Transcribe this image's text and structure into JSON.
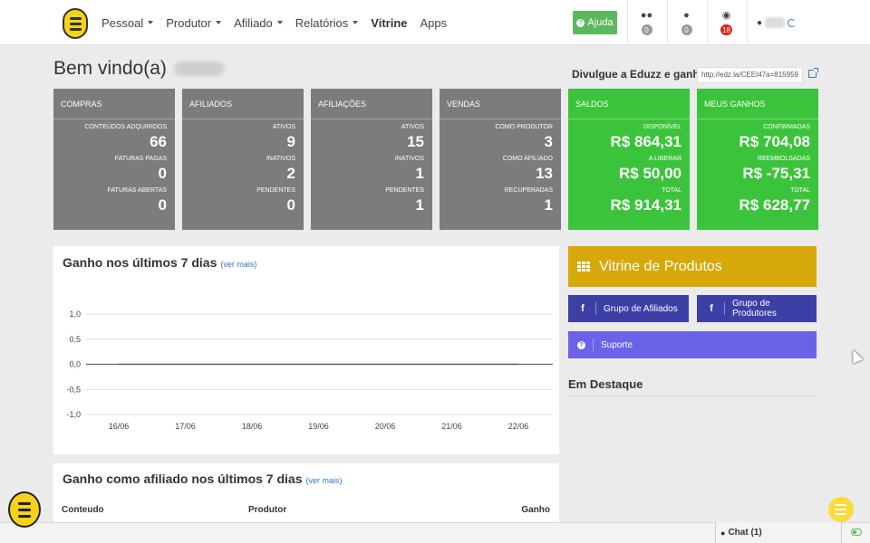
{
  "nav": {
    "menu": [
      {
        "label": "Pessoal",
        "dropdown": true
      },
      {
        "label": "Produtor",
        "dropdown": true
      },
      {
        "label": "Afiliado",
        "dropdown": true
      },
      {
        "label": "Relatórios",
        "dropdown": true
      },
      {
        "label": "Vitrine",
        "dropdown": false
      },
      {
        "label": "Apps",
        "dropdown": false
      }
    ],
    "help_label": "Ajuda",
    "users_count": "0",
    "messages_count": "0",
    "notifications_count": "18"
  },
  "welcome": "Bem vindo(a)",
  "promo": {
    "label": "Divulgue a Eduzz e ganhe!",
    "ref_link": "http://edz.la/CEEI47a=815959"
  },
  "stats": [
    {
      "title": "COMPRAS",
      "rows": [
        {
          "label": "CONTEÚDOS ADQUIRIDOS",
          "value": "66"
        },
        {
          "label": "FATURAS PAGAS",
          "value": "0"
        },
        {
          "label": "FATURAS ABERTAS",
          "value": "0"
        }
      ]
    },
    {
      "title": "AFILIADOS",
      "rows": [
        {
          "label": "ATIVOS",
          "value": "9"
        },
        {
          "label": "INATIVOS",
          "value": "2"
        },
        {
          "label": "PENDENTES",
          "value": "0"
        }
      ]
    },
    {
      "title": "AFILIAÇÕES",
      "rows": [
        {
          "label": "ATIVOS",
          "value": "15"
        },
        {
          "label": "INATIVOS",
          "value": "1"
        },
        {
          "label": "PENDENTES",
          "value": "1"
        }
      ]
    },
    {
      "title": "VENDAS",
      "rows": [
        {
          "label": "COMO PRODUTOR",
          "value": "3"
        },
        {
          "label": "COMO AFILIADO",
          "value": "13"
        },
        {
          "label": "RECUPERADAS",
          "value": "1"
        }
      ]
    },
    {
      "title": "SALDOS",
      "rows": [
        {
          "label": "DISPONÍVEL",
          "value": "R$ 864,31"
        },
        {
          "label": "A LIBERAR",
          "value": "R$ 50,00"
        },
        {
          "label": "TOTAL",
          "value": "R$ 914,31"
        }
      ]
    },
    {
      "title": "MEUS GANHOS",
      "rows": [
        {
          "label": "CONFIRMADAS",
          "value": "R$ 704,08"
        },
        {
          "label": "REEMBOLSADAS",
          "value": "R$ -75,31"
        },
        {
          "label": "TOTAL",
          "value": "R$ 628,77"
        }
      ]
    }
  ],
  "chart_card": {
    "title": "Ganho nos últimos 7 dias",
    "more": "(ver mais)"
  },
  "chart_data": {
    "type": "line",
    "x": [
      "16/06",
      "17/06",
      "18/06",
      "19/06",
      "20/06",
      "21/06",
      "22/06"
    ],
    "series": [
      {
        "values": [
          0,
          0,
          0,
          0,
          0,
          0,
          0
        ]
      }
    ],
    "yticks": [
      "1,0",
      "0,5",
      "0,0",
      "-0,5",
      "-1,0"
    ],
    "ylim": [
      -1,
      1
    ],
    "grid": true
  },
  "affiliate_card": {
    "title": "Ganho como afiliado nos últimos 7 dias",
    "more": "(ver mais)",
    "columns": [
      "Conteudo",
      "Produtor",
      "Ganho"
    ]
  },
  "right_panel": {
    "vitrine": "Vitrine de Produtos",
    "group_affiliates": "Grupo de Afiliados",
    "group_producers": "Grupo de Produtores",
    "support": "Suporte",
    "highlight": "Em Destaque"
  },
  "footer": {
    "chat": "Chat (1)"
  },
  "colors": {
    "grey_box": "#7c7c7c",
    "green_box": "#3bc43b",
    "vitrine": "#d7a80a",
    "btn_dark": "#3d3fa6",
    "btn_light": "#6a62e8"
  }
}
